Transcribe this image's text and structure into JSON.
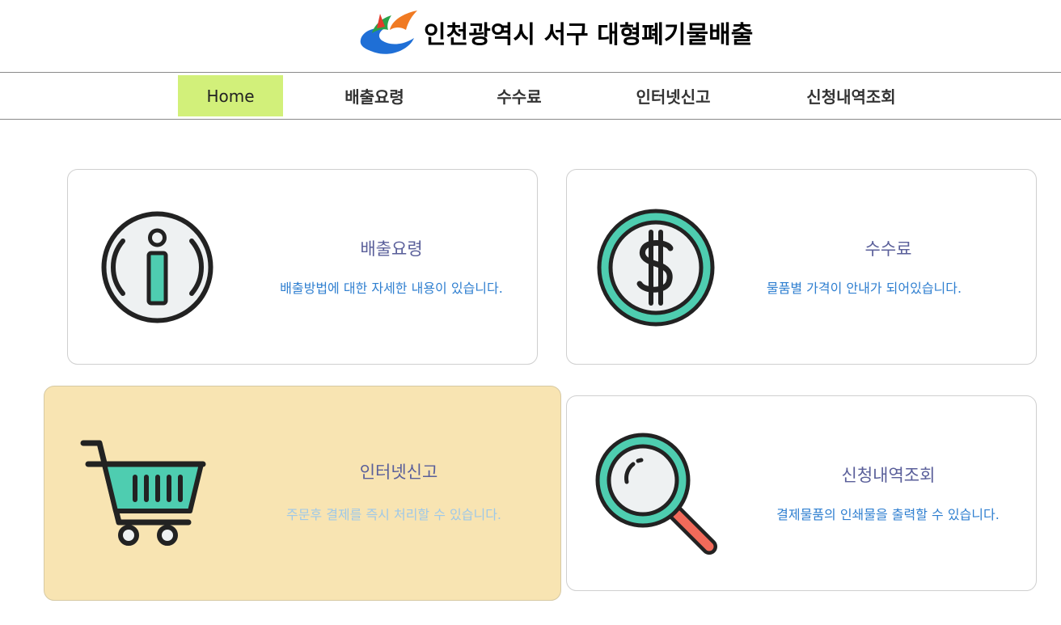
{
  "header": {
    "title": "인천광역시 서구  대형폐기물배출"
  },
  "nav": {
    "items": [
      {
        "label": "Home",
        "active": true
      },
      {
        "label": "배출요령"
      },
      {
        "label": "수수료"
      },
      {
        "label": "인터넷신고"
      },
      {
        "label": "신청내역조회"
      }
    ]
  },
  "cards": [
    {
      "title": "배출요령",
      "description": "배출방법에 대한 자세한 내용이 있습니다.",
      "icon": "info-icon"
    },
    {
      "title": "수수료",
      "description": "물품별 가격이 안내가 되어있습니다.",
      "icon": "dollar-coin-icon"
    },
    {
      "title": "인터넷신고",
      "description": "주문후 결제를 즉시 처리할 수 있습니다.",
      "icon": "shopping-cart-icon",
      "hovered": true
    },
    {
      "title": "신청내역조회",
      "description": "결제물품의 인쇄물을 출력할 수 있습니다.",
      "icon": "magnifier-icon"
    }
  ],
  "colors": {
    "nav_active_bg": "#d2f07a",
    "card_hover_bg": "#f8e4b2",
    "icon_teal": "#4ecdb0",
    "card_title": "#5a5f9a",
    "card_desc": "#2f7fd0"
  }
}
